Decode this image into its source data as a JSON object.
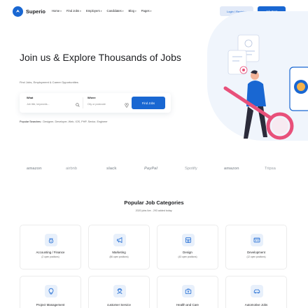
{
  "header": {
    "logo_text": "Superio",
    "nav": [
      {
        "label": "Home",
        "icon": "chevron-down-icon"
      },
      {
        "label": "Find Jobs",
        "icon": "chevron-down-icon"
      },
      {
        "label": "Employers",
        "icon": "chevron-down-icon"
      },
      {
        "label": "Candidates",
        "icon": "chevron-down-icon"
      },
      {
        "label": "Blog",
        "icon": "chevron-down-icon"
      },
      {
        "label": "Pages",
        "icon": "chevron-down-icon"
      }
    ],
    "login_label": "Login / Register",
    "job_post_label": "Job Post"
  },
  "hero": {
    "title": "Join us & Explore Thousands of Jobs",
    "subtitle": "Find Jobs, Employment & Career Opportunities",
    "search": {
      "what_label": "What",
      "what_placeholder": "Job title, keywords...",
      "where_label": "Where",
      "where_placeholder": "City or postcode",
      "find_label": "Find Jobs"
    },
    "popular_label": "Popular Searches :",
    "popular_tags": "Designer, Developer, Web, IOS, PHP, Senior, Engineer"
  },
  "brands": [
    "amazon",
    "airbnb",
    "slack",
    "PayPal",
    "Spotify",
    "amazon",
    "Tripsa"
  ],
  "categories_section": {
    "title": "Popular Job Categories",
    "subtitle": "2020 jobs live - 293 added today."
  },
  "categories": [
    {
      "name": "Accounting / Finance",
      "count": "(2 open positions)",
      "icon": "money-bag-icon"
    },
    {
      "name": "Marketing",
      "count": "(86 open positions)",
      "icon": "megaphone-icon"
    },
    {
      "name": "Design",
      "count": "(43 open positions)",
      "icon": "design-tools-icon"
    },
    {
      "name": "Development",
      "count": "(12 open positions)",
      "icon": "code-window-icon"
    },
    {
      "name": "Project Management",
      "count": "",
      "icon": "lightbulb-icon"
    },
    {
      "name": "customer Service",
      "count": "",
      "icon": "headset-agent-icon"
    },
    {
      "name": "Health and Care",
      "count": "",
      "icon": "first-aid-kit-icon"
    },
    {
      "name": "Automotive Jobs",
      "count": "",
      "icon": "car-icon"
    }
  ],
  "colors": {
    "primary": "#1967d2",
    "primary_light": "#e2eaf8",
    "illustration_pink": "#e8507a",
    "illustration_bg": "#f0f5fc"
  }
}
